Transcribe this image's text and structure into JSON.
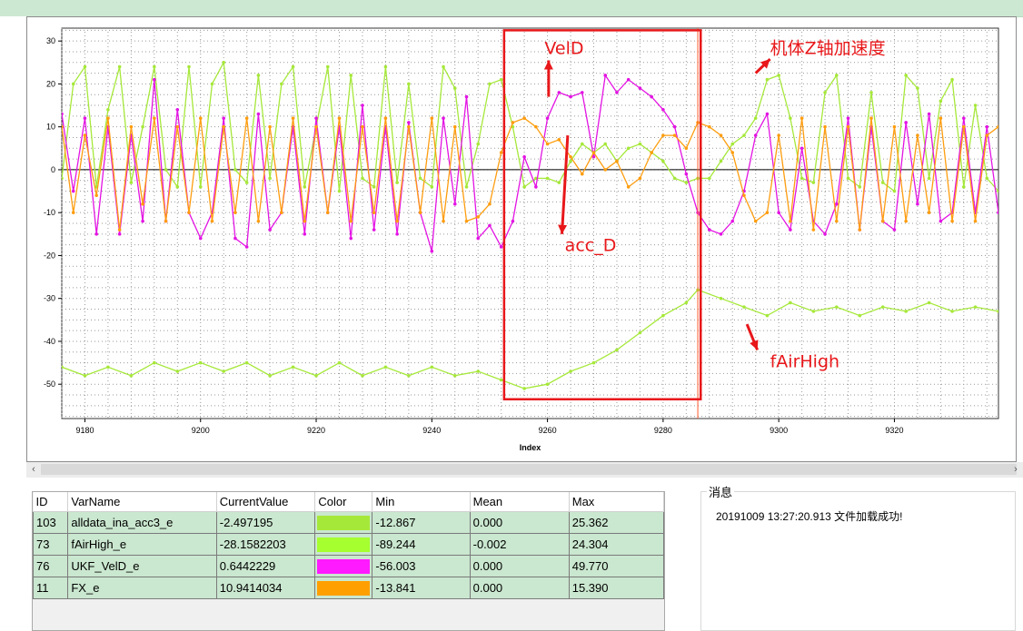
{
  "chart_data": {
    "type": "line",
    "xlabel": "Index",
    "ylabel": "",
    "xlim": [
      9176,
      9338
    ],
    "ylim": [
      -58,
      33
    ],
    "x_ticks": [
      9180,
      9200,
      9220,
      9240,
      9260,
      9280,
      9300,
      9320
    ],
    "y_ticks": [
      30,
      20,
      10,
      0,
      -10,
      -20,
      -30,
      -40,
      -50
    ],
    "grid": true,
    "series": [
      {
        "name": "alldata_ina_acc3_e",
        "color": "#a6e83a",
        "x": [
          9176,
          9178,
          9180,
          9182,
          9184,
          9186,
          9188,
          9190,
          9192,
          9194,
          9196,
          9198,
          9200,
          9202,
          9204,
          9206,
          9208,
          9210,
          9212,
          9214,
          9216,
          9218,
          9220,
          9222,
          9224,
          9226,
          9228,
          9230,
          9232,
          9234,
          9236,
          9238,
          9240,
          9242,
          9244,
          9246,
          9248,
          9250,
          9252,
          9254,
          9256,
          9258,
          9260,
          9262,
          9264,
          9266,
          9268,
          9270,
          9272,
          9274,
          9276,
          9278,
          9280,
          9282,
          9284,
          9286,
          9288,
          9290,
          9292,
          9294,
          9296,
          9298,
          9300,
          9302,
          9304,
          9306,
          9308,
          9310,
          9312,
          9314,
          9316,
          9318,
          9320,
          9322,
          9324,
          9326,
          9328,
          9330,
          9332,
          9334,
          9336,
          9338
        ],
        "y": [
          -2,
          20,
          24,
          -4,
          14,
          24,
          -3,
          10,
          24,
          0,
          -4,
          24,
          -4,
          20,
          25,
          0,
          -3,
          22,
          -2,
          20,
          24,
          -4,
          10,
          24,
          -5,
          22,
          -2,
          -4,
          24,
          -3,
          20,
          -2,
          -4,
          24,
          19,
          -4,
          6,
          20,
          21,
          10,
          -4,
          -2,
          -2,
          -3,
          2,
          6,
          4,
          6,
          2,
          5,
          6,
          4,
          2,
          -2,
          -3,
          -2,
          -2,
          2,
          6,
          8,
          12,
          21,
          22,
          12,
          -2,
          -3,
          18,
          22,
          -2,
          -4,
          18,
          -3,
          -5,
          22,
          19,
          -2,
          16,
          21,
          -4,
          15,
          -2,
          -5
        ]
      },
      {
        "name": "fAirHigh_e",
        "color": "#a6e83a",
        "x": [
          9176,
          9180,
          9184,
          9188,
          9192,
          9196,
          9200,
          9204,
          9208,
          9212,
          9216,
          9220,
          9224,
          9228,
          9232,
          9236,
          9240,
          9244,
          9248,
          9252,
          9256,
          9260,
          9264,
          9268,
          9272,
          9276,
          9280,
          9284,
          9286,
          9290,
          9294,
          9298,
          9302,
          9306,
          9310,
          9314,
          9318,
          9322,
          9326,
          9330,
          9334,
          9338
        ],
        "y": [
          -46,
          -48,
          -46,
          -48,
          -45,
          -47,
          -45,
          -47,
          -45,
          -48,
          -46,
          -48,
          -45,
          -48,
          -46,
          -48,
          -46,
          -48,
          -47,
          -49,
          -51,
          -50,
          -47,
          -45,
          -42,
          -38,
          -34,
          -31,
          -28,
          -30,
          -32,
          -34,
          -31,
          -33,
          -32,
          -34,
          -32,
          -33,
          -31,
          -33,
          -32,
          -33
        ]
      },
      {
        "name": "UKF_VelD_e",
        "color": "#e314e3",
        "x": [
          9176,
          9178,
          9180,
          9182,
          9184,
          9186,
          9188,
          9190,
          9192,
          9194,
          9196,
          9198,
          9200,
          9202,
          9204,
          9206,
          9208,
          9210,
          9212,
          9214,
          9216,
          9218,
          9220,
          9222,
          9224,
          9226,
          9228,
          9230,
          9232,
          9234,
          9236,
          9238,
          9240,
          9242,
          9244,
          9246,
          9248,
          9250,
          9252,
          9254,
          9256,
          9258,
          9260,
          9262,
          9264,
          9266,
          9268,
          9270,
          9272,
          9274,
          9276,
          9278,
          9280,
          9282,
          9284,
          9286,
          9288,
          9290,
          9292,
          9294,
          9296,
          9298,
          9300,
          9302,
          9304,
          9306,
          9308,
          9310,
          9312,
          9314,
          9316,
          9318,
          9320,
          9322,
          9324,
          9326,
          9328,
          9330,
          9332,
          9334,
          9336,
          9338
        ],
        "y": [
          13,
          -5,
          12,
          -15,
          10,
          -15,
          8,
          -12,
          21,
          -12,
          14,
          -10,
          -16,
          -10,
          12,
          -16,
          -18,
          13,
          -14,
          -10,
          10,
          -15,
          12,
          -10,
          10,
          -16,
          15,
          -14,
          10,
          -15,
          11,
          -10,
          -19,
          12,
          -8,
          17,
          -16,
          -13,
          -18,
          -12,
          3,
          -4,
          12,
          18,
          17,
          18,
          3,
          22,
          18,
          21,
          19,
          17,
          14,
          10,
          -1,
          -10,
          -14,
          -15,
          -12,
          -5,
          8,
          13,
          -10,
          -14,
          5,
          -12,
          -15,
          -8,
          12,
          -14,
          10,
          -12,
          -14,
          11,
          -8,
          13,
          -12,
          -10,
          12,
          -10,
          10,
          -10
        ]
      },
      {
        "name": "FX_e",
        "color": "#ff9d0f",
        "x": [
          9176,
          9178,
          9180,
          9182,
          9184,
          9186,
          9188,
          9190,
          9192,
          9194,
          9196,
          9198,
          9200,
          9202,
          9204,
          9206,
          9208,
          9210,
          9212,
          9214,
          9216,
          9218,
          9220,
          9222,
          9224,
          9226,
          9228,
          9230,
          9232,
          9234,
          9236,
          9238,
          9240,
          9242,
          9244,
          9246,
          9248,
          9250,
          9252,
          9254,
          9256,
          9258,
          9260,
          9262,
          9264,
          9266,
          9268,
          9270,
          9272,
          9274,
          9276,
          9278,
          9280,
          9282,
          9284,
          9286,
          9288,
          9290,
          9292,
          9294,
          9296,
          9298,
          9300,
          9302,
          9304,
          9306,
          9308,
          9310,
          9312,
          9314,
          9316,
          9318,
          9320,
          9322,
          9324,
          9326,
          9328,
          9330,
          9332,
          9334,
          9336,
          9338
        ],
        "y": [
          10,
          -10,
          8,
          -6,
          12,
          -14,
          10,
          -8,
          12,
          -12,
          10,
          -10,
          12,
          -12,
          10,
          -10,
          12,
          -12,
          10,
          -10,
          12,
          -12,
          10,
          -10,
          12,
          -12,
          10,
          -10,
          12,
          -12,
          10,
          -10,
          12,
          -12,
          10,
          -12,
          -11,
          -8,
          4,
          11,
          12,
          10,
          6,
          7,
          3,
          -1,
          4,
          0,
          2,
          -4,
          -2,
          4,
          8,
          8,
          5,
          11,
          10,
          8,
          4,
          -6,
          -12,
          -10,
          8,
          -12,
          12,
          -14,
          10,
          -12,
          10,
          -14,
          12,
          -12,
          10,
          -12,
          8,
          -10,
          12,
          -12,
          10,
          -12,
          8,
          10
        ]
      }
    ],
    "vlines": [
      {
        "x": 9286,
        "color": "#ff5a2a"
      }
    ],
    "highlight_box": {
      "x": [
        9252.5,
        9286.5
      ],
      "y": [
        -53.5,
        32.5
      ],
      "color": "#e8171a"
    },
    "annotations": [
      {
        "text": "VelD",
        "x": 9259.5,
        "y": 27
      },
      {
        "text": "acc_D",
        "x": 9263,
        "y": -19
      },
      {
        "text": "机体Z轴加速度",
        "x": 9298.5,
        "y": 27
      },
      {
        "text": "fAirHigh",
        "x": 9298.5,
        "y": -46
      }
    ]
  },
  "table": {
    "headers": [
      "ID",
      "VarName",
      "CurrentValue",
      "Color",
      "Min",
      "Mean",
      "Max"
    ],
    "rows": [
      {
        "id": "103",
        "name": "alldata_ina_acc3_e",
        "current": "-2.497195",
        "color": "#a6e83a",
        "min": "-12.867",
        "mean": "0.000",
        "max": "25.362"
      },
      {
        "id": "73",
        "name": "fAirHigh_e",
        "current": "-28.1582203",
        "color": "#a6ff2e",
        "min": "-89.244",
        "mean": "-0.002",
        "max": "24.304"
      },
      {
        "id": "76",
        "name": "UKF_VelD_e",
        "current": "0.6442229",
        "color": "#ff1aff",
        "min": "-56.003",
        "mean": "0.000",
        "max": "49.770"
      },
      {
        "id": "11",
        "name": "FX_e",
        "current": "10.9414034",
        "color": "#ffa000",
        "min": "-13.841",
        "mean": "0.000",
        "max": "15.390"
      }
    ]
  },
  "messages": {
    "title": "消息",
    "lines": [
      "20191009 13:27:20.913 文件加载成功!"
    ]
  },
  "scrollbar": {
    "left_arrow": "‹",
    "right_arrow": "›"
  }
}
